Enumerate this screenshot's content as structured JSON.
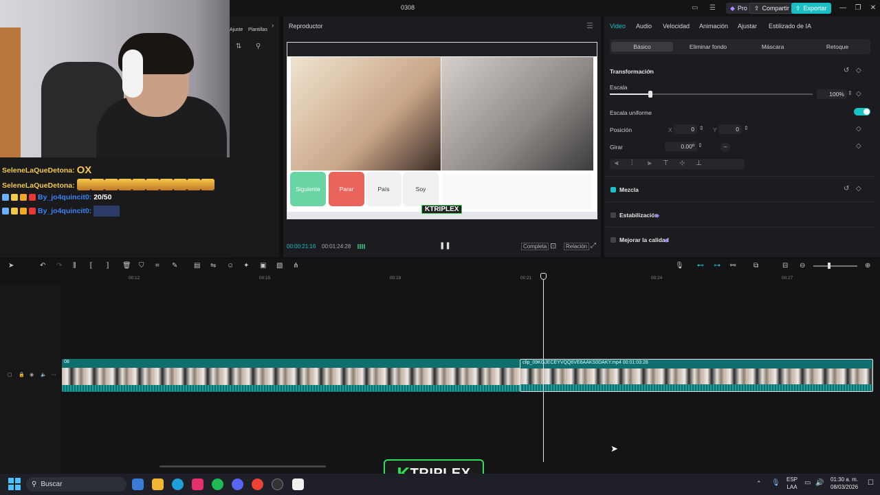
{
  "window": {
    "title": "0308",
    "pro_label": "Pro",
    "share_label": "Compartir",
    "export_label": "Exportar"
  },
  "left_panel": {
    "adjust_label": "Ajuste",
    "templates_label": "Plantillas"
  },
  "chat": {
    "lines": [
      {
        "user": "SeleneLaQueDetona:",
        "msg": "OX"
      },
      {
        "user": "SeleneLaQueDetona:",
        "msg": ""
      },
      {
        "user": "By_jo4quincit0:",
        "msg": "20/50"
      },
      {
        "user": "By_jo4quincit0:",
        "msg": ""
      }
    ]
  },
  "player": {
    "title": "Reproductor",
    "current_time": "00:00:21:16",
    "total_time": "00:01:24:28",
    "btn_full": "Completa",
    "btn_ratio": "Relación",
    "preview": {
      "btn_next": "Siguiente",
      "btn_stop": "Parar",
      "btn_country": "País",
      "btn_soy": "Soy",
      "watermark": "KTRIPLEX"
    }
  },
  "inspector": {
    "tabs": [
      "Video",
      "Audio",
      "Velocidad",
      "Animación",
      "Ajustar",
      "Estilizado de IA"
    ],
    "subtabs": [
      "Básico",
      "Eliminar fondo",
      "Máscara",
      "Retoque"
    ],
    "transform_label": "Transformación",
    "scale_label": "Escala",
    "scale_value": "100%",
    "scale_fraction": 0.2,
    "uniform_label": "Escala uniforme",
    "position_label": "Posición",
    "pos_x_label": "X",
    "pos_x": "0",
    "pos_y_label": "Y",
    "pos_y": "0",
    "rotate_label": "Girar",
    "rotate_value": "0.00º",
    "blend_label": "Mezcla",
    "stabilize_label": "Estabilización",
    "enhance_label": "Mejorar la calidad"
  },
  "timeline": {
    "ticks": [
      "00:12",
      "00:15",
      "00:18",
      "00:21",
      "00:24",
      "00:27"
    ],
    "clip1_name": "08",
    "clip2_name": "clip_09KGJECEYVQQ6VE6AAKS0DAKY.mp4   00:01:03:28"
  },
  "taskbar": {
    "search_placeholder": "Buscar",
    "lang_top": "ESP",
    "lang_bottom": "LAA",
    "time": "01:30 a. m.",
    "date": "08/03/2026"
  },
  "overlay_logo": {
    "k": "K",
    "rest": "TRIPLEX"
  },
  "colors": {
    "accent": "#19c2c5",
    "export": "#19bfc2",
    "clip": "#0f6e6e",
    "logo_green": "#2ee05a"
  }
}
